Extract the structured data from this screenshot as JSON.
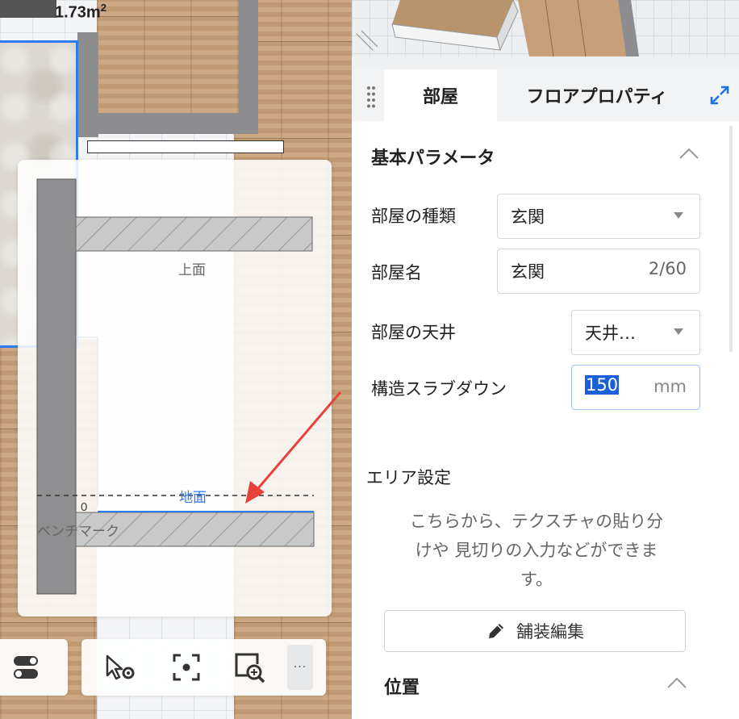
{
  "canvas": {
    "area_value": "1.73m",
    "area_unit_sup": "2"
  },
  "section_diagram": {
    "top_label": "上面",
    "floor_label": "地面",
    "benchmark_label": "ベンチマーク",
    "zero_label": "0"
  },
  "toolbar": {
    "more_label": "···"
  },
  "panel": {
    "tabs": [
      {
        "label": "部屋",
        "active": true
      },
      {
        "label": "フロアプロパティ",
        "active": false
      }
    ],
    "basic": {
      "title": "基本パラメータ",
      "room_type_label": "部屋の種類",
      "room_type_value": "玄関",
      "room_name_label": "部屋名",
      "room_name_value": "玄関",
      "room_name_count": "2/60",
      "ceiling_label": "部屋の天井",
      "ceiling_value": "天井…",
      "slab_label": "構造スラブダウン",
      "slab_value": "150",
      "slab_unit": "mm"
    },
    "area": {
      "title": "エリア設定",
      "description_line1": "こちらから、テクスチャの貼り分",
      "description_line2": "けや 見切りの入力などができま",
      "description_line3": "す。",
      "edit_button": "舗装編集"
    },
    "position": {
      "title": "位置"
    }
  },
  "colors": {
    "accent": "#2f7bf0",
    "selection": "#1d5fd6",
    "annotation_arrow": "#e8413c"
  }
}
